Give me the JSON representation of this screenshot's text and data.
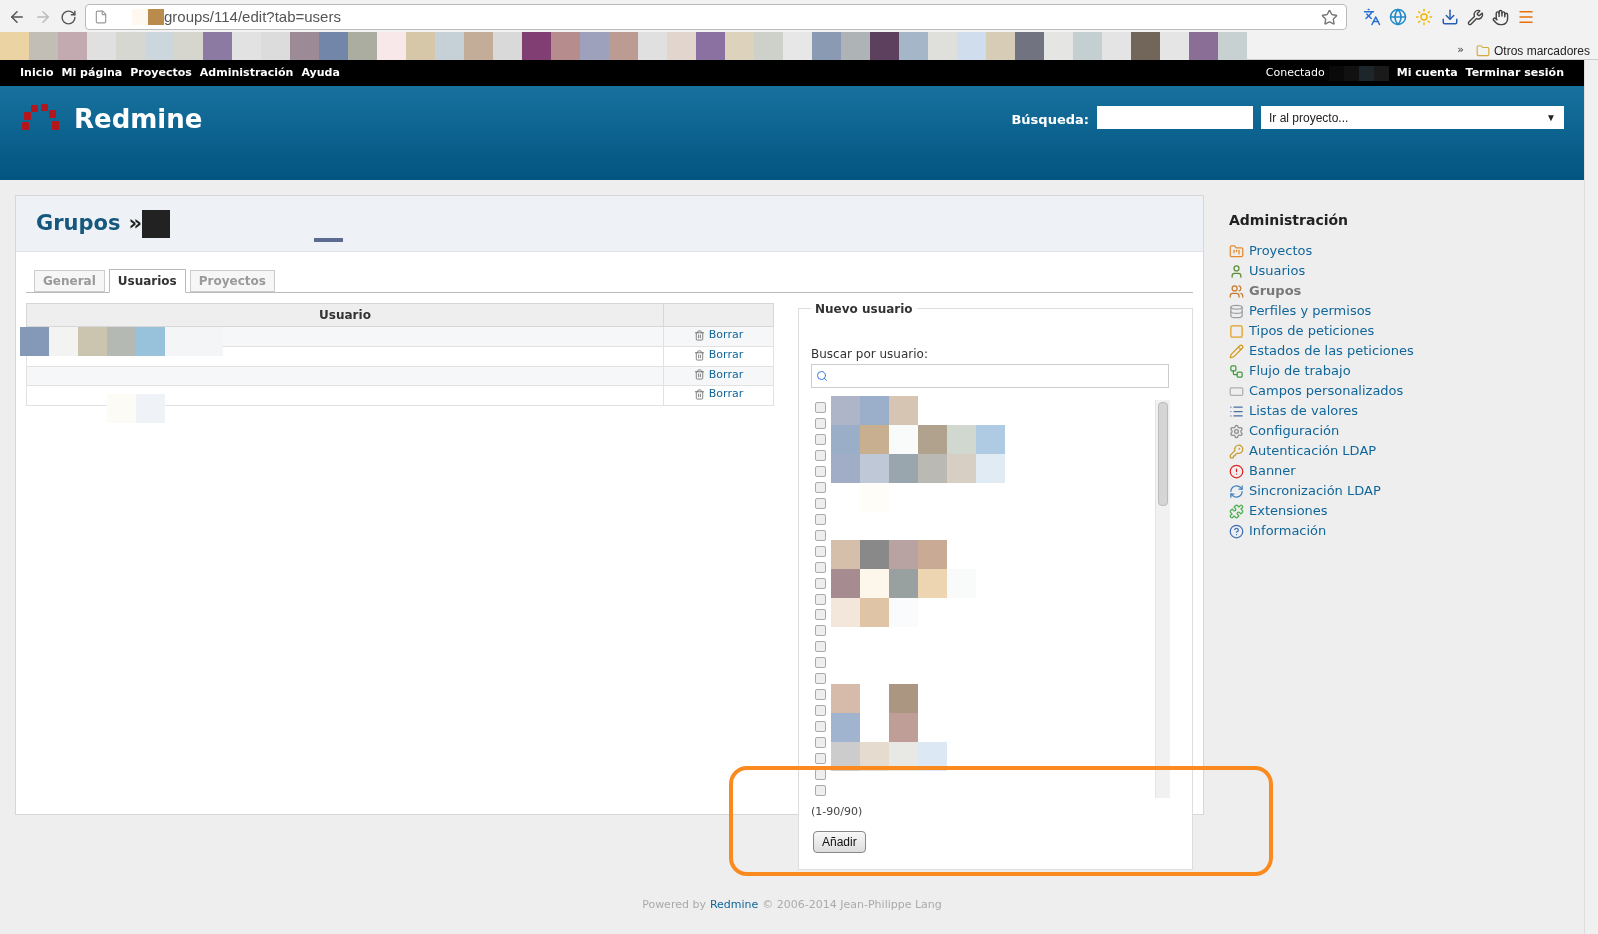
{
  "browser": {
    "url": "groups/114/edit?tab=users",
    "bookmarks_overflow": "»",
    "other_bookmarks": "Otros marcadores"
  },
  "top_menu": {
    "items": [
      "Inicio",
      "Mi página",
      "Proyectos",
      "Administración",
      "Ayuda"
    ],
    "logged_in": "Conectado",
    "account_links": [
      "Mi cuenta",
      "Terminar sesión"
    ]
  },
  "header": {
    "title": "Redmine",
    "search_label": "Búsqueda:",
    "project_select": "Ir al proyecto...",
    "select_arrow": "▼"
  },
  "page": {
    "title": "Grupos",
    "separator": "»"
  },
  "tabs": [
    {
      "label": "General",
      "selected": false
    },
    {
      "label": "Usuarios",
      "selected": true
    },
    {
      "label": "Proyectos",
      "selected": false
    }
  ],
  "users_table": {
    "column": "Usuario",
    "rows": [
      {
        "action": "Borrar"
      },
      {
        "action": "Borrar"
      },
      {
        "action": "Borrar"
      },
      {
        "action": "Borrar"
      }
    ]
  },
  "new_user": {
    "legend": "Nuevo usuario",
    "search_label": "Buscar por usuario:",
    "users": [
      {
        "checked": false
      },
      {
        "checked": false
      },
      {
        "checked": false
      },
      {
        "checked": false
      },
      {
        "checked": false
      },
      {
        "checked": false
      },
      {
        "checked": false
      },
      {
        "checked": false
      },
      {
        "checked": false
      },
      {
        "checked": false
      },
      {
        "checked": false
      },
      {
        "checked": false
      },
      {
        "checked": false
      },
      {
        "checked": false
      },
      {
        "checked": false
      },
      {
        "checked": false
      },
      {
        "checked": false
      },
      {
        "checked": false
      },
      {
        "checked": false
      },
      {
        "checked": false
      },
      {
        "checked": false
      },
      {
        "checked": false
      },
      {
        "checked": false
      },
      {
        "checked": false
      },
      {
        "checked": false
      }
    ],
    "count": "(1-90/90)",
    "button": "Añadir"
  },
  "sidebar": {
    "title": "Administración",
    "items": [
      {
        "label": "Proyectos",
        "selected": false
      },
      {
        "label": "Usuarios",
        "selected": false
      },
      {
        "label": "Grupos",
        "selected": true
      },
      {
        "label": "Perfiles y permisos",
        "selected": false
      },
      {
        "label": "Tipos de peticiones",
        "selected": false
      },
      {
        "label": "Estados de las peticiones",
        "selected": false
      },
      {
        "label": "Flujo de trabajo",
        "selected": false
      },
      {
        "label": "Campos personalizados",
        "selected": false
      },
      {
        "label": "Listas de valores",
        "selected": false
      },
      {
        "label": "Configuración",
        "selected": false
      },
      {
        "label": "Autenticación LDAP",
        "selected": false
      },
      {
        "label": "Banner",
        "selected": false
      },
      {
        "label": "Sincronización LDAP",
        "selected": false
      },
      {
        "label": "Extensiones",
        "selected": false
      },
      {
        "label": "Información",
        "selected": false
      }
    ]
  },
  "footer": {
    "prefix": "Powered by",
    "link": "Redmine",
    "suffix": "© 2006-2014 Jean-Philippe Lang"
  }
}
